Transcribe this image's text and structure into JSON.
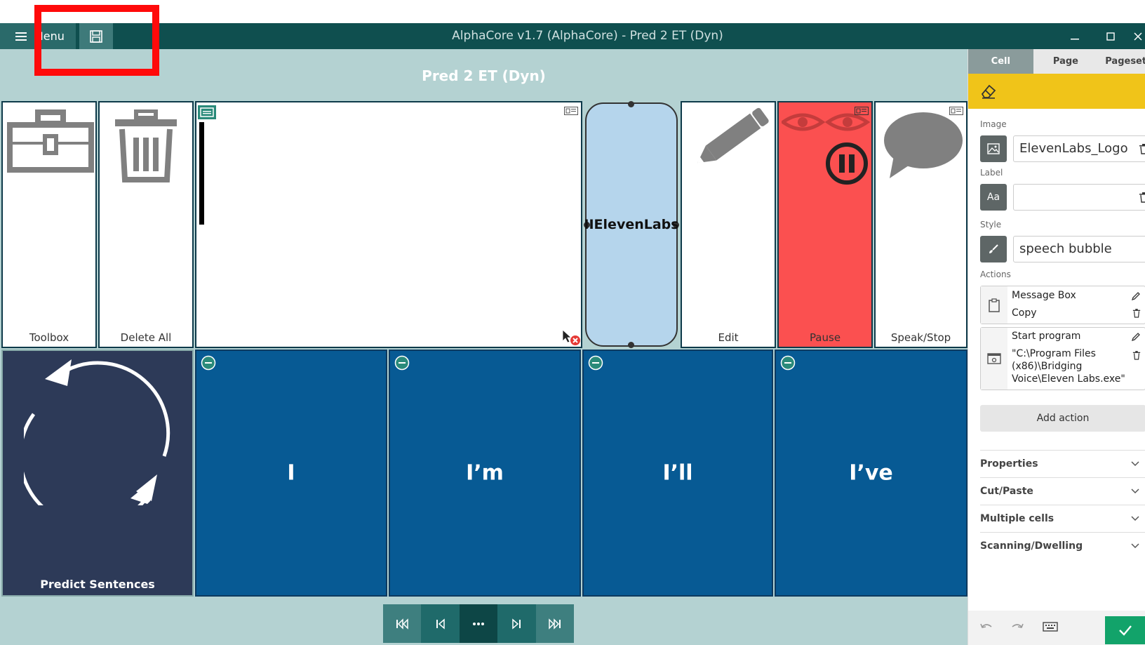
{
  "window": {
    "title": "AlphaCore v1.7 (AlphaCore) - Pred 2 ET (Dyn)",
    "menu_label": "Menu"
  },
  "page": {
    "title": "Pred 2 ET (Dyn)"
  },
  "grid": {
    "top_cells": [
      {
        "label": "Toolbox"
      },
      {
        "label": "Delete All"
      },
      {
        "label": ""
      },
      {
        "label": "IIElevenLabs"
      },
      {
        "label": "Edit"
      },
      {
        "label": "Pause"
      },
      {
        "label": "Speak/Stop"
      }
    ],
    "predict_label": "Predict Sentences",
    "words": [
      "I",
      "I’m",
      "I’ll",
      "I’ve"
    ]
  },
  "panel": {
    "tabs": [
      "Cell",
      "Page",
      "Pageset"
    ],
    "active_tab": "Cell",
    "image_title": "Image",
    "image_value": "ElevenLabs_Logo",
    "label_title": "Label",
    "label_value": "",
    "style_title": "Style",
    "style_value": "speech bubble",
    "actions_title": "Actions",
    "action1": {
      "line1": "Message Box",
      "line2": "Copy"
    },
    "action2": {
      "line1": "Start program",
      "line2": "\"C:\\Program Files",
      "line3": "(x86)\\Bridging",
      "line4": "Voice\\Eleven Labs.exe\""
    },
    "add_action": "Add action",
    "accordions": [
      "Properties",
      "Cut/Paste",
      "Multiple cells",
      "Scanning/Dwelling"
    ]
  },
  "colors": {
    "titlebar": "#0f4f4f",
    "page_bg": "#b4d2d2",
    "word_cell": "#075a94",
    "predict_cell": "#2d3a58",
    "selected_cell": "#b5d5ec",
    "pause_cell": "#fb5050",
    "edit_strip": "#f0c419",
    "highlight": "#ff0a0a"
  }
}
